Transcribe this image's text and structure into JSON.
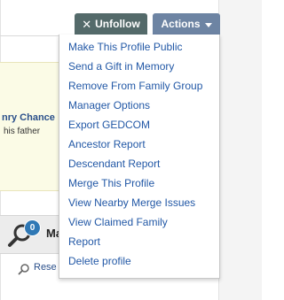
{
  "toolbar": {
    "unfollow": {
      "icon": "close-icon",
      "glyph": "✕",
      "label": "Unfollow"
    },
    "actions": {
      "label": "Actions",
      "icon": "caret-down-icon"
    }
  },
  "notice": {
    "name_fragment": "nry Chance",
    "sub_fragment": "his father"
  },
  "tabs": {
    "badge_count": "0",
    "label_fragment": "Ma"
  },
  "search": {
    "icon": "search-icon",
    "label_fragment": "Rese"
  },
  "menu": {
    "items": [
      {
        "label": "Make This Profile Public"
      },
      {
        "label": "Send a Gift in Memory"
      },
      {
        "label": "Remove From Family Group"
      },
      {
        "label": "Manager Options"
      },
      {
        "label": "Export GEDCOM"
      },
      {
        "label": "Ancestor Report"
      },
      {
        "label": "Descendant Report"
      },
      {
        "label": "Merge This Profile"
      },
      {
        "label": "View Nearby Merge Issues"
      },
      {
        "label": "View Claimed Family"
      },
      {
        "label": "Report"
      },
      {
        "label": "Delete profile"
      }
    ]
  },
  "colors": {
    "unfollow_bg": "#546a6a",
    "actions_bg": "#6d84a3",
    "link": "#2258a6",
    "badge": "#2f78b5",
    "notice_bg": "#fbfbe6"
  }
}
